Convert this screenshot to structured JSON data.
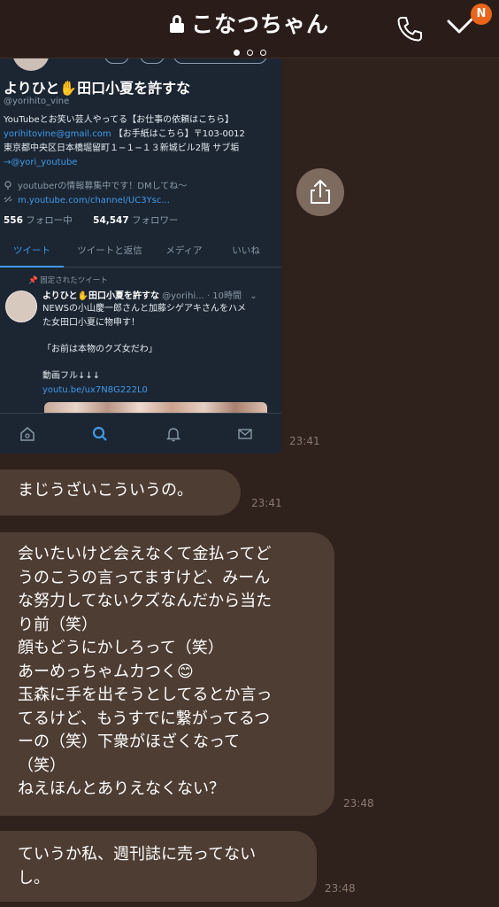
{
  "header": {
    "title": "こなつちゃん",
    "badge": "N"
  },
  "screenshot": {
    "name": "よりひと✋田口小夏を許すな",
    "handle": "@yorihito_vine",
    "bio_line1": "YouTubeとお笑い芸人やってる【お仕事の依頼はこちら】",
    "bio_email": "yorihitovine@gmail.com",
    "bio_line2_rest": "【お手紙はこちら】〒103-0012",
    "bio_line3": "東京都中央区日本橋堀留町１−１−１３新城ビル2階 サブ垢",
    "bio_link": "→@yori_youtube",
    "meta_info": "youtuberの情報募集中です！DMしてね〜",
    "meta_url": "m.youtube.com/channel/UC3Ysc...",
    "following_count": "556",
    "following_label": "フォロー中",
    "followers_count": "54,547",
    "followers_label": "フォロワー",
    "tabs": [
      "ツイート",
      "ツイートと返信",
      "メディア",
      "いいね"
    ],
    "pinned_label": "固定されたツイート",
    "tweet_author": "よりひと✋田口小夏を許すな",
    "tweet_handle": "@yorihi...",
    "tweet_time": "· 10時間",
    "tweet_line1": "NEWSの小山慶一郎さんと加藤シゲアキさんをハメ",
    "tweet_line2": "た女田口小夏に物申す！",
    "tweet_line3": "「お前は本物のクズ女だわ」",
    "tweet_line4": "動画フル↓↓↓",
    "tweet_link": "youtu.be/ux7N8G222L0"
  },
  "messages": [
    {
      "time": "23:41",
      "text": "まじうざいこういうの。"
    },
    {
      "time": "23:48",
      "text": "会いたいけど会えなくて金払ってど\nうのこうの言ってますけど、みーん\nな努力してないクズなんだから当た\nり前（笑）\n顔もどうにかしろって（笑）\nあーめっちゃムカつく😊\n玉森に手を出そうとしてるとか言っ\nてるけど、もうすでに繋がってるつ\nーの（笑）下衆がほざくなって\n（笑）\nねえほんとありえなくない？"
    },
    {
      "time": "23:48",
      "text": "ていうか私、週刊誌に売ってない\nし。"
    }
  ],
  "screenshot_time": "23:41"
}
